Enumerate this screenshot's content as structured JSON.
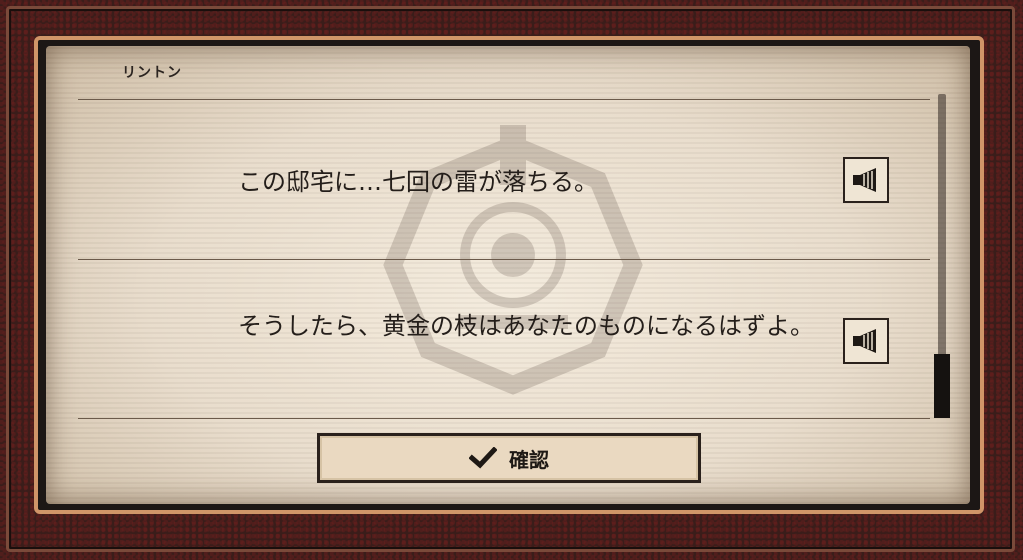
{
  "speaker": {
    "name": "リントン"
  },
  "lines": [
    {
      "text": "この邸宅に…七回の雷が落ちる。",
      "voice_icon": "speaker-icon"
    },
    {
      "text": "そうしたら、黄金の枝はあなたのものになるはずよ。",
      "voice_icon": "speaker-icon"
    }
  ],
  "confirm": {
    "label": "確認",
    "icon": "check-icon"
  },
  "colors": {
    "frame": "#3a1d1a",
    "accent": "#d09568",
    "paper": "#ece1d0",
    "ink": "#241e1a"
  }
}
